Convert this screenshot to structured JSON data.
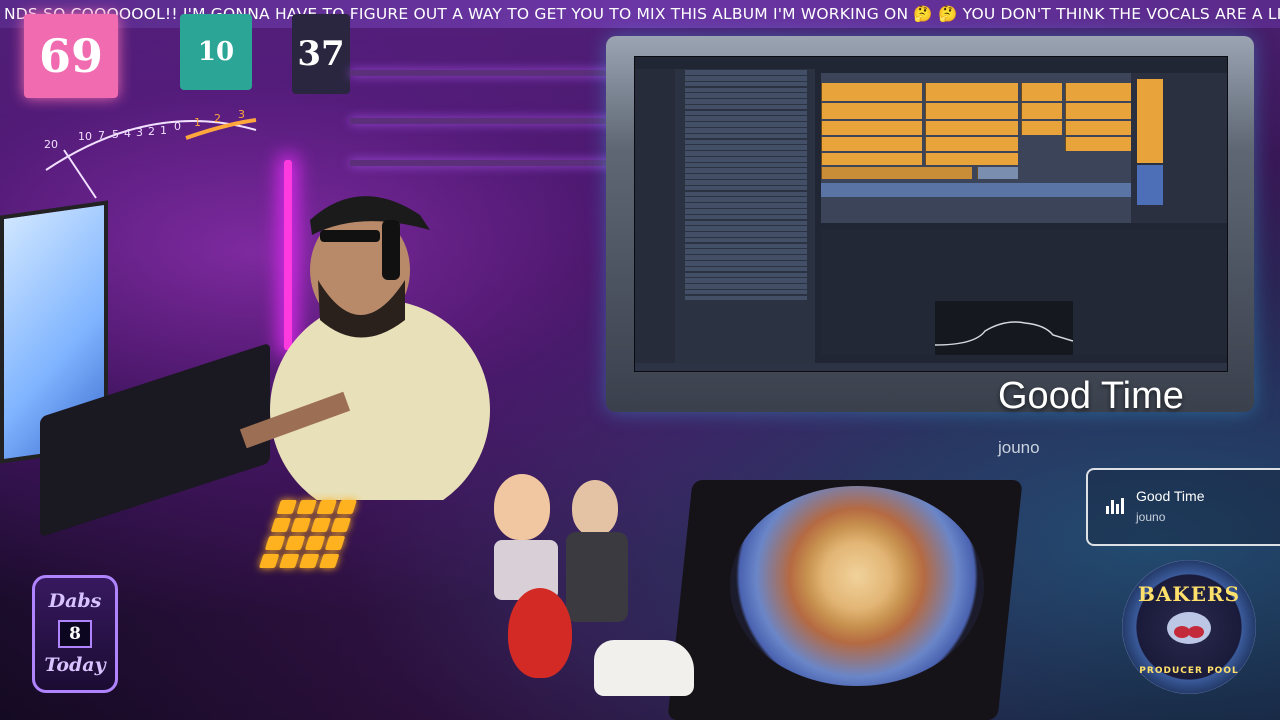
{
  "ticker": {
    "text": "NDS SO COOOOOOL!! I'M GONNA HAVE TO FIGURE OUT A WAY TO GET YOU TO MIX THIS ALBUM I'M WORKING ON 🤔 🤔  YOU DON'T THINK THE VOCALS ARE A LITTLE LOW? WORD!"
  },
  "wall_signs": {
    "left": "69",
    "middle": "10",
    "right": "37"
  },
  "vu_meter": {
    "scale": [
      "20",
      "10",
      "7",
      "5",
      "4",
      "3",
      "2",
      "1",
      "0",
      "1",
      "2",
      "3"
    ]
  },
  "now_playing": {
    "title": "Good Time",
    "artist": "jouno"
  },
  "now_playing_card": {
    "title": "Good Time",
    "artist": "jouno",
    "icon": "equalizer-bars-icon"
  },
  "dabs_badge": {
    "line1": "Dabs",
    "count": "8",
    "line2": "Today"
  },
  "bakers_badge": {
    "line1": "BAKERS",
    "line2": "PRODUCER POOL",
    "icon": "chef-hat-icon"
  },
  "daw": {
    "accent": "#e9a33b",
    "background": "#202634"
  },
  "colors": {
    "ticker_bg": "#5a2a8a",
    "neon_pink": "#ff3be0",
    "pad_orange": "#ffb21f",
    "frame_glow": "#3cc8ff"
  }
}
